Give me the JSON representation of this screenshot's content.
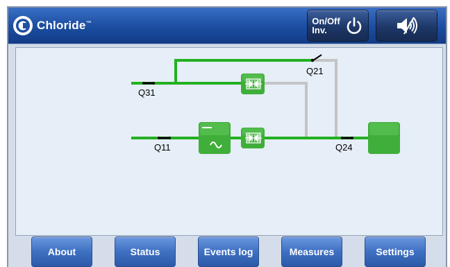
{
  "header": {
    "brand": "Chloride",
    "brand_tm": "™",
    "onoff_label": "On/Off\nInv."
  },
  "diagram": {
    "switches": {
      "q31": "Q31",
      "q21": "Q21",
      "q11": "Q11",
      "q24": "Q24"
    },
    "colors": {
      "active_line": "#22b022",
      "inactive_line": "#c4c4c4",
      "block_green": "#3fae3a"
    }
  },
  "footer": {
    "buttons": [
      "About",
      "Status",
      "Events log",
      "Measures",
      "Settings"
    ]
  }
}
